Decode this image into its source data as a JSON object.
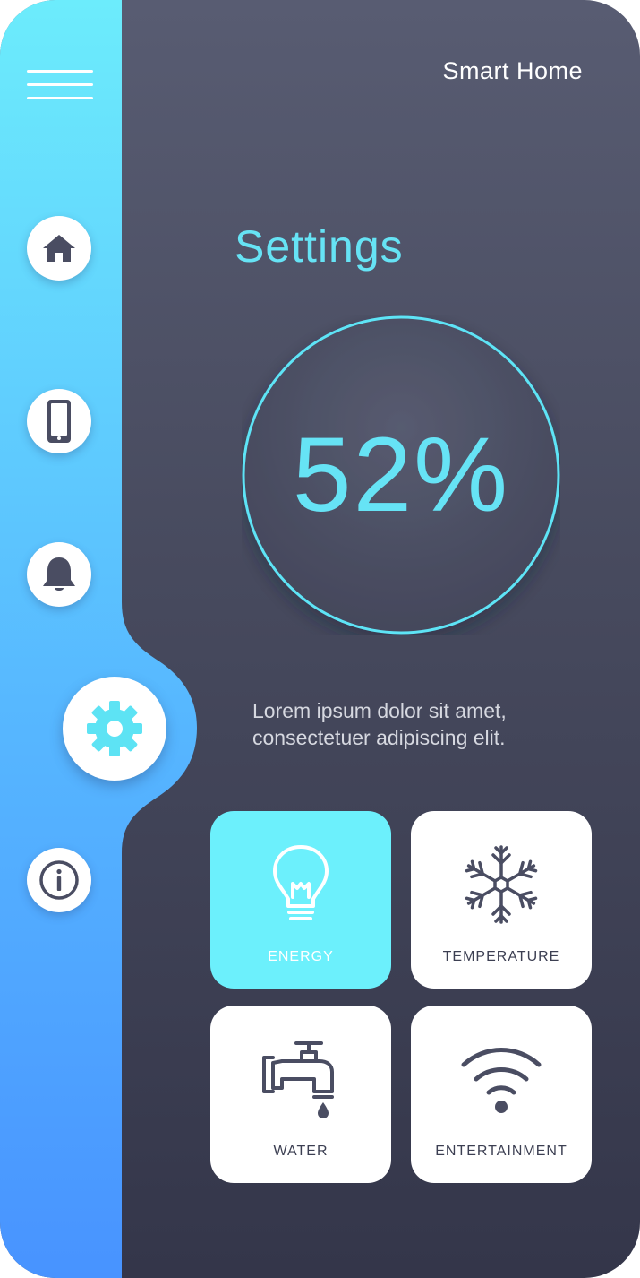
{
  "header": {
    "title": "Smart Home"
  },
  "page": {
    "title": "Settings"
  },
  "gauge": {
    "value_label": "52%",
    "percent": 52
  },
  "description": {
    "line1": "Lorem ipsum dolor sit amet,",
    "line2": "consectetuer adipiscing elit."
  },
  "sidebar": {
    "items": [
      {
        "icon": "home-icon"
      },
      {
        "icon": "phone-icon"
      },
      {
        "icon": "bell-icon"
      },
      {
        "icon": "gear-icon",
        "active": true
      },
      {
        "icon": "info-icon"
      }
    ]
  },
  "tiles": [
    {
      "label": "ENERGY",
      "icon": "lightbulb-icon",
      "active": true
    },
    {
      "label": "TEMPERATURE",
      "icon": "snowflake-icon"
    },
    {
      "label": "WATER",
      "icon": "faucet-icon"
    },
    {
      "label": "ENTERTAINMENT",
      "icon": "wifi-icon"
    }
  ],
  "colors": {
    "accent": "#66e3f5",
    "rail_top": "#6cecfc",
    "rail_bottom": "#4893ff",
    "background_top": "#585c72",
    "background_bottom": "#34364a",
    "icon_dark": "#4a4d62"
  }
}
